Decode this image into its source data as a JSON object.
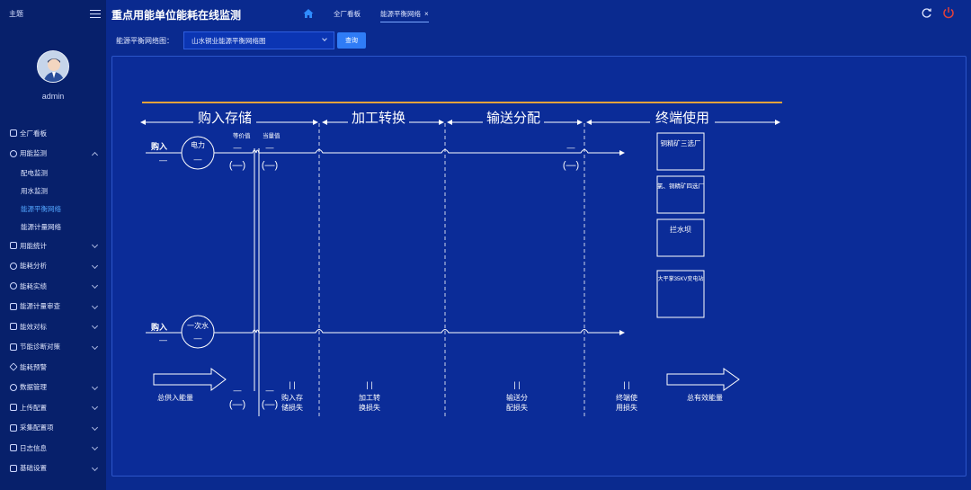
{
  "sidebar": {
    "theme_label": "主题",
    "username": "admin",
    "items": [
      {
        "label": "全厂看板"
      },
      {
        "label": "用能监测"
      },
      {
        "label": "用能统计"
      },
      {
        "label": "能耗分析"
      },
      {
        "label": "能耗实绩"
      },
      {
        "label": "能源计量审查"
      },
      {
        "label": "能效对标"
      },
      {
        "label": "节能诊断对策"
      },
      {
        "label": "能耗预警"
      },
      {
        "label": "数据管理"
      },
      {
        "label": "上传配置"
      },
      {
        "label": "采集配置项"
      },
      {
        "label": "日志信息"
      },
      {
        "label": "基础设置"
      }
    ],
    "sub_items": [
      {
        "label": "配电监测"
      },
      {
        "label": "用水监测"
      },
      {
        "label": "能源平衡网络"
      },
      {
        "label": "能源计量网络"
      }
    ]
  },
  "header": {
    "title": "重点用能单位能耗在线监测",
    "tabs": [
      {
        "label": "全厂看板"
      },
      {
        "label": "能源平衡网络",
        "close": "×"
      }
    ]
  },
  "filter": {
    "label": "能源平衡网络图：",
    "selected": "山水铜业能源平衡网络图",
    "query_label": "查询"
  },
  "diagram": {
    "stages": [
      "购入存储",
      "加工转换",
      "输送分配",
      "终端使用"
    ],
    "col_labels": [
      "等价值",
      "当量值"
    ],
    "rows": [
      {
        "buy_label": "购入",
        "dash": "—",
        "source": "电力",
        "source_dash": "—",
        "v1": "(—)",
        "v2": "(—)",
        "v3": "(—)"
      },
      {
        "buy_label": "购入",
        "dash": "—",
        "source": "一次水",
        "source_dash": "—"
      }
    ],
    "terminals": [
      "铜精矿三选厂",
      "氯、铜精矿四选厂",
      "拦水坝",
      "大平掌35KV变电站"
    ],
    "bottom": {
      "total_in": "总供入能量",
      "loss_dash_top": "—",
      "loss_paren_1": "(—)",
      "loss_paren_2": "(—)",
      "loss_bars": "| |",
      "loss_1": [
        "购入存",
        "储损失"
      ],
      "loss_2": [
        "加工转",
        "换损失"
      ],
      "loss_3": [
        "输送分",
        "配损失"
      ],
      "loss_4": [
        "终端使",
        "用损失"
      ],
      "total_out": "总有效能量"
    }
  },
  "colors": {
    "bg": "#0a2a8f",
    "sidebar": "#07206b",
    "accent": "#2f7cf6",
    "orange_line": "#e3a23b",
    "power_icon": "#e0413c"
  }
}
